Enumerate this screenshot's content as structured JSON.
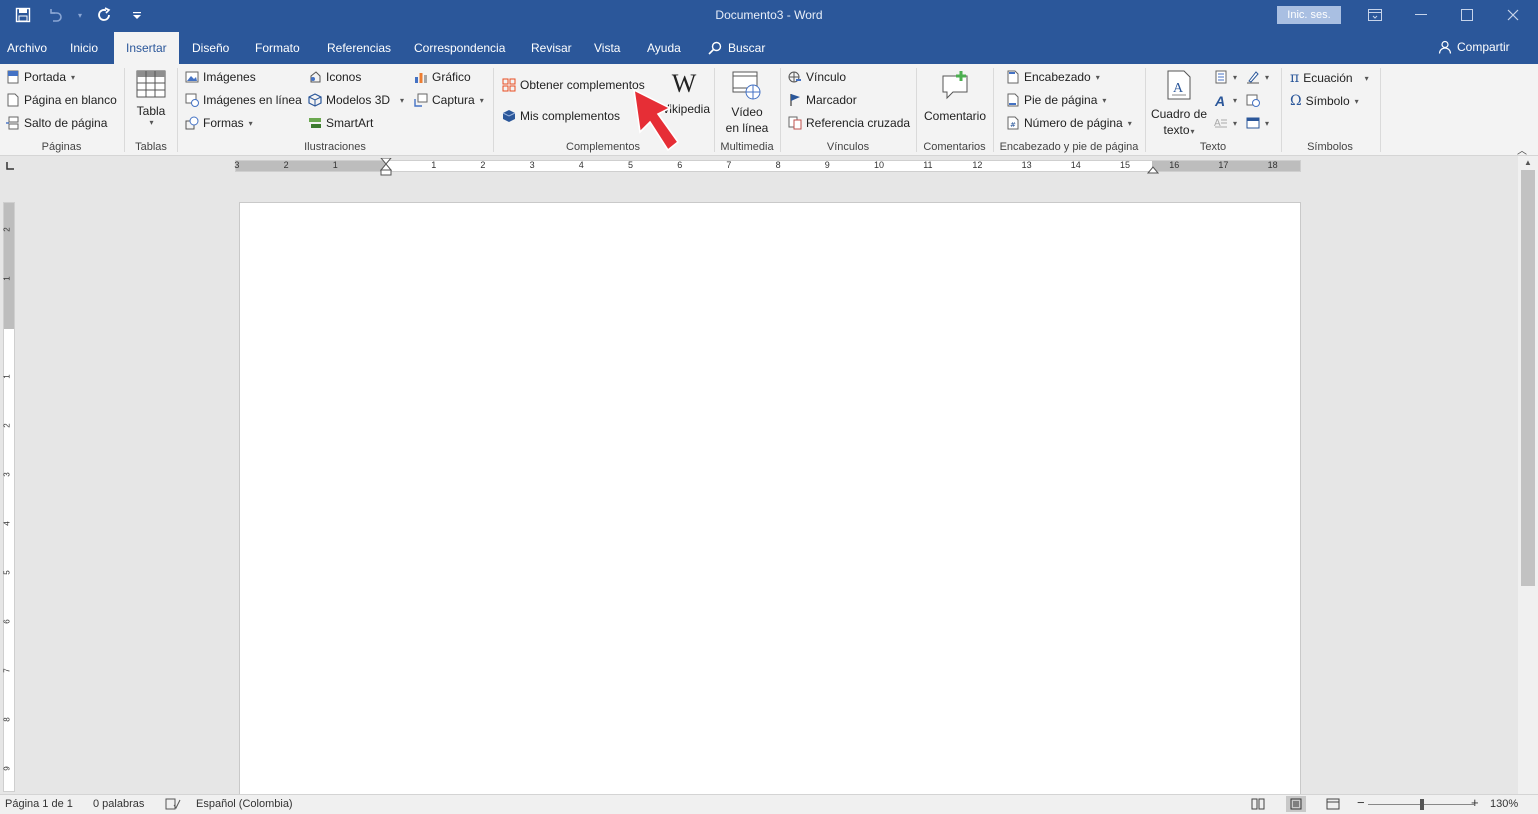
{
  "titlebar": {
    "title": "Documento3  -  Word",
    "signin": "Inic. ses.",
    "color": "#2b579a"
  },
  "tabs": [
    {
      "label": "Archivo"
    },
    {
      "label": "Inicio"
    },
    {
      "label": "Insertar",
      "active": true
    },
    {
      "label": "Diseño"
    },
    {
      "label": "Formato"
    },
    {
      "label": "Referencias"
    },
    {
      "label": "Correspondencia"
    },
    {
      "label": "Revisar"
    },
    {
      "label": "Vista"
    },
    {
      "label": "Ayuda"
    }
  ],
  "search": {
    "label": "Buscar"
  },
  "share": {
    "label": "Compartir"
  },
  "ribbon": {
    "paginas": {
      "label": "Páginas",
      "portada": "Portada",
      "blanco": "Página en blanco",
      "salto": "Salto de página"
    },
    "tablas": {
      "label": "Tablas",
      "tabla": "Tabla"
    },
    "ilustraciones": {
      "label": "Ilustraciones",
      "imagenes": "Imágenes",
      "imagenes_linea": "Imágenes en línea",
      "formas": "Formas",
      "iconos": "Iconos",
      "modelos3d": "Modelos 3D",
      "smartart": "SmartArt",
      "grafico": "Gráfico",
      "captura": "Captura"
    },
    "complementos": {
      "label": "Complementos",
      "obtener": "Obtener complementos",
      "mis": "Mis complementos",
      "wikipedia": "Wikipedia",
      "wiki_glyph": "W"
    },
    "multimedia": {
      "label": "Multimedia",
      "video_1": "Vídeo",
      "video_2": "en línea"
    },
    "vinculos": {
      "label": "Vínculos",
      "vinculo": "Vínculo",
      "marcador": "Marcador",
      "referencia": "Referencia cruzada"
    },
    "comentarios": {
      "label": "Comentarios",
      "comentario": "Comentario"
    },
    "encabezado": {
      "label": "Encabezado y pie de página",
      "encabezado": "Encabezado",
      "pie": "Pie de página",
      "numero": "Número de página"
    },
    "texto": {
      "label": "Texto",
      "cuadro_1": "Cuadro de",
      "cuadro_2": "texto"
    },
    "simbolos": {
      "label": "Símbolos",
      "ecuacion": "Ecuación",
      "simbolo": "Símbolo"
    }
  },
  "ruler": {
    "h_numbers": [
      "3",
      "2",
      "1",
      "1",
      "2",
      "3",
      "4",
      "5",
      "6",
      "7",
      "8",
      "9",
      "10",
      "11",
      "12",
      "13",
      "14",
      "15",
      "16",
      "17",
      "18"
    ],
    "v_numbers": [
      "2",
      "1",
      "1",
      "2",
      "3",
      "4",
      "5",
      "6",
      "7",
      "8",
      "9"
    ]
  },
  "status": {
    "page": "Página 1 de 1",
    "words": "0 palabras",
    "language": "Español (Colombia)",
    "zoom": "130%",
    "zoom_minus": "−",
    "zoom_plus": "+"
  },
  "icons": {
    "save": "save-icon",
    "undo": "undo-icon",
    "redo": "redo-icon",
    "customize": "customize-qat-icon",
    "restore": "ribbon-display-icon",
    "minimize": "minimize-icon",
    "maximize": "maximize-icon",
    "close": "close-icon"
  }
}
